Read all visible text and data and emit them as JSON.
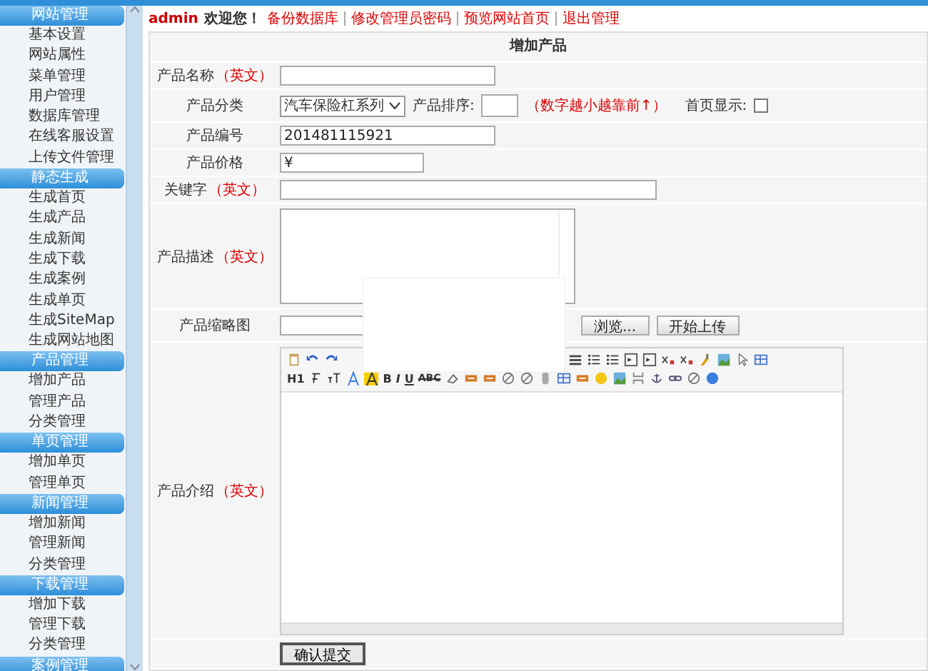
{
  "sidebar": {
    "sections": [
      {
        "title": "网站管理",
        "items": [
          "基本设置",
          "网站属性",
          "菜单管理",
          "用户管理",
          "数据库管理",
          "在线客服设置",
          "上传文件管理"
        ]
      },
      {
        "title": "静态生成",
        "items": [
          "生成首页",
          "生成产品",
          "生成新闻",
          "生成下载",
          "生成案例",
          "生成单页",
          "生成SiteMap",
          "生成网站地图"
        ]
      },
      {
        "title": "产品管理",
        "items": [
          "增加产品",
          "管理产品",
          "分类管理"
        ]
      },
      {
        "title": "单页管理",
        "items": [
          "增加单页",
          "管理单页"
        ]
      },
      {
        "title": "新闻管理",
        "items": [
          "增加新闻",
          "管理新闻",
          "分类管理"
        ]
      },
      {
        "title": "下载管理",
        "items": [
          "增加下载",
          "管理下载",
          "分类管理"
        ]
      },
      {
        "title": "案例管理"
      }
    ]
  },
  "topbar": {
    "user": "admin",
    "greeting": "欢迎您！",
    "links": [
      "备份数据库",
      "修改管理员密码",
      "预览网站首页",
      "退出管理"
    ]
  },
  "form": {
    "title": "增加产品",
    "fields": [
      {
        "kind": "text",
        "label": "产品名称",
        "note": "（英文）"
      },
      {
        "kind": "category",
        "label": "产品分类",
        "select": "汽车保险杠系列",
        "sort_label": "产品排序:",
        "hint": "（数字越小越靠前↑）",
        "home_label": "首页显示:",
        "home_checked": false
      },
      {
        "kind": "text",
        "label": "产品编号",
        "value": "201481115921"
      },
      {
        "kind": "shorttext",
        "label": "产品价格",
        "value": "¥"
      },
      {
        "kind": "longtext",
        "label": "关键字",
        "note": "（英文）"
      },
      {
        "kind": "textarea",
        "label": "产品描述",
        "note": "（英文）"
      },
      {
        "kind": "file",
        "label": "产品缩略图",
        "buttons": [
          "浏览...",
          "开始上传"
        ]
      },
      {
        "kind": "editor",
        "label": "产品介绍",
        "note": "（英文）",
        "toolbar_text": [
          "H1",
          "B",
          "I",
          "U",
          "ABC"
        ]
      },
      {
        "kind": "submit",
        "button": "确认提交"
      }
    ]
  }
}
